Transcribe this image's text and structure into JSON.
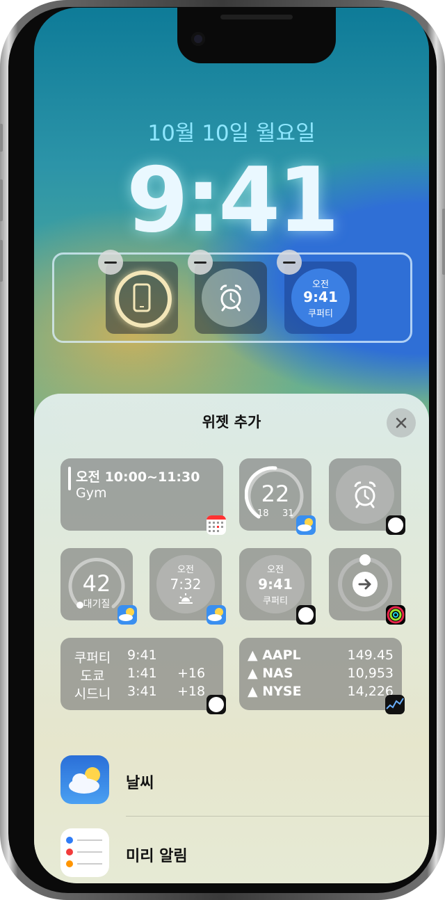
{
  "lock_screen": {
    "date": "10월 10일 월요일",
    "time": "9:41",
    "widgets": [
      {
        "name": "battery"
      },
      {
        "name": "alarm"
      },
      {
        "name": "world-clock",
        "line1": "오전",
        "line2": "9:41",
        "line3": "쿠퍼티"
      }
    ]
  },
  "sheet": {
    "title": "위젯 추가",
    "calendar_widget": {
      "time": "오전 10:00~11:30",
      "event": "Gym"
    },
    "weather_temp_widget": {
      "temp": "22",
      "low": "18",
      "high": "31"
    },
    "air_quality_widget": {
      "value": "42",
      "label": "대기질"
    },
    "sunrise_widget": {
      "ampm": "오전",
      "time": "7:32"
    },
    "clock_widget": {
      "ampm": "오전",
      "time": "9:41",
      "city": "쿠퍼티"
    },
    "world_clock_widget": {
      "rows": [
        {
          "city": "쿠퍼티",
          "time": "9:41",
          "offset": ""
        },
        {
          "city": "도쿄",
          "time": "1:41",
          "offset": "+16"
        },
        {
          "city": "시드니",
          "time": "3:41",
          "offset": "+18"
        }
      ]
    },
    "stocks_widget": {
      "rows": [
        {
          "symbol": "▲ AAPL",
          "value": "149.45"
        },
        {
          "symbol": "▲ NAS",
          "value": "10,953"
        },
        {
          "symbol": "▲ NYSE",
          "value": "14,226"
        }
      ]
    },
    "apps": [
      {
        "name": "날씨",
        "icon": "weather-icon"
      },
      {
        "name": "미리 알림",
        "icon": "reminders-icon"
      }
    ]
  },
  "colors": {
    "accent_date": "#8ee7ff",
    "weather_blue": "#3a8ff0",
    "fitness_ring": "#e5254b"
  }
}
